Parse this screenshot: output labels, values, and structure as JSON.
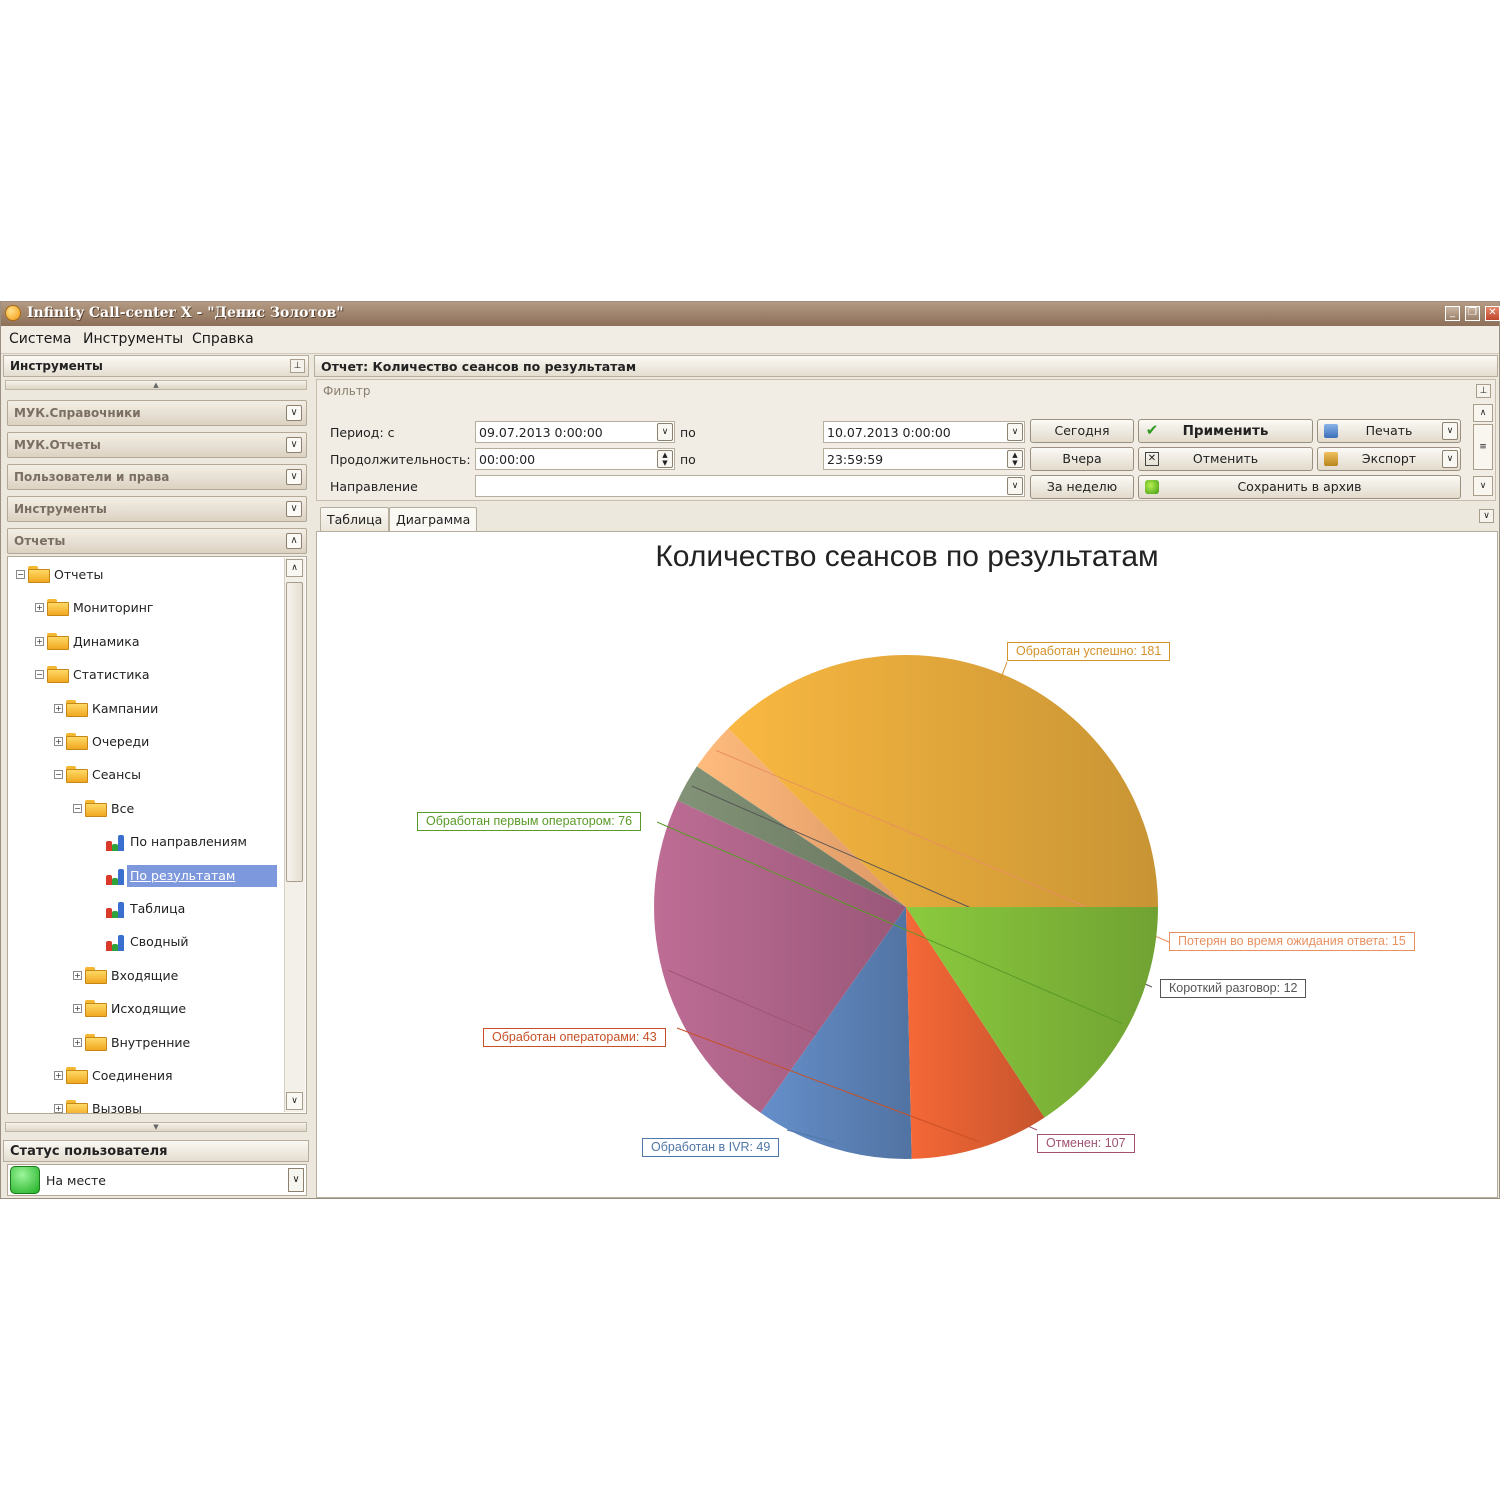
{
  "window": {
    "title": "Infinity Call-center X - \"Денис Золотов\"",
    "min": "_",
    "restore": "❐",
    "close": "✕"
  },
  "menu": [
    "Система",
    "Инструменты",
    "Справка"
  ],
  "left_panel": {
    "title": "Инструменты",
    "sections": [
      "МУК.Справочники",
      "МУК.Отчеты",
      "Пользователи и права",
      "Инструменты",
      "Отчеты"
    ],
    "tree": [
      {
        "label": "Отчеты",
        "level": 0,
        "icon": "folder",
        "expander": "−"
      },
      {
        "label": "Мониторинг",
        "level": 1,
        "icon": "folder",
        "expander": "+"
      },
      {
        "label": "Динамика",
        "level": 1,
        "icon": "folder",
        "expander": "+"
      },
      {
        "label": "Статистика",
        "level": 1,
        "icon": "folder",
        "expander": "−"
      },
      {
        "label": "Кампании",
        "level": 2,
        "icon": "folder",
        "expander": "+"
      },
      {
        "label": "Очереди",
        "level": 2,
        "icon": "folder",
        "expander": "+"
      },
      {
        "label": "Сеансы",
        "level": 2,
        "icon": "folder",
        "expander": "−"
      },
      {
        "label": "Все",
        "level": 3,
        "icon": "folder",
        "expander": "−"
      },
      {
        "label": "По направлениям",
        "level": 4,
        "icon": "report",
        "expander": ""
      },
      {
        "label": "По результатам",
        "level": 4,
        "icon": "report",
        "expander": "",
        "selected": true
      },
      {
        "label": "Таблица",
        "level": 4,
        "icon": "report",
        "expander": ""
      },
      {
        "label": "Сводный",
        "level": 4,
        "icon": "report",
        "expander": ""
      },
      {
        "label": "Входящие",
        "level": 3,
        "icon": "folder",
        "expander": "+"
      },
      {
        "label": "Исходящие",
        "level": 3,
        "icon": "folder",
        "expander": "+"
      },
      {
        "label": "Внутренние",
        "level": 3,
        "icon": "folder",
        "expander": "+"
      },
      {
        "label": "Соединения",
        "level": 2,
        "icon": "folder",
        "expander": "+"
      },
      {
        "label": "Вызовы",
        "level": 2,
        "icon": "folder",
        "expander": "+"
      }
    ],
    "user_status_title": "Статус пользователя",
    "user_status_value": "На месте"
  },
  "report": {
    "title": "Отчет: Количество сеансов по результатам",
    "filter": {
      "title": "Фильтр",
      "period_label": "Период: с",
      "period_from": "09.07.2013 0:00:00",
      "to_label": "по",
      "period_to": "10.07.2013 0:00:00",
      "duration_label": "Продолжительность: с",
      "duration_from": "00:00:00",
      "duration_to": "23:59:59",
      "direction_label": "Направление",
      "direction_value": ""
    },
    "buttons": {
      "today": "Сегодня",
      "yesterday": "Вчера",
      "week": "За неделю",
      "apply": "Применить",
      "cancel": "Отменить",
      "save_archive": "Сохранить в архив",
      "print": "Печать",
      "export": "Экспорт"
    },
    "tabs": [
      "Таблица",
      "Диаграмма"
    ]
  },
  "chart_data": {
    "type": "pie",
    "title": "Количество сеансов по результатам",
    "slices": [
      {
        "label": "Обработан успешно",
        "value": 181,
        "color": "#dea43a"
      },
      {
        "label": "Потерян во время ожидания ответа",
        "value": 15,
        "color": "#f4a870"
      },
      {
        "label": "Короткий разговор",
        "value": 12,
        "color": "#74836a"
      },
      {
        "label": "Отменен",
        "value": 107,
        "color": "#aa6185"
      },
      {
        "label": "Обработан в IVR",
        "value": 49,
        "color": "#5a80b4"
      },
      {
        "label": "Обработан операторами",
        "value": 43,
        "color": "#dc5d31"
      },
      {
        "label": "Обработан первым оператором",
        "value": 76,
        "color": "#7cb437"
      }
    ],
    "label_colors": [
      "#d4922a",
      "#e89060",
      "#555555",
      "#a05272",
      "#4f76a8",
      "#c75026",
      "#5a9a28"
    ]
  }
}
